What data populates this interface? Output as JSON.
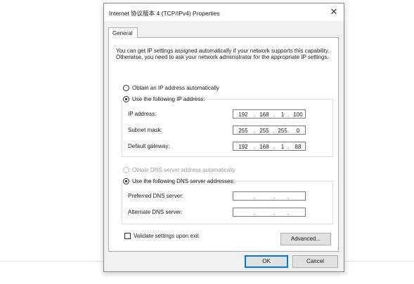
{
  "window": {
    "title": "Internet 协议版本 4 (TCP/IPv4) Properties",
    "close_glyph": "✕"
  },
  "tabs": [
    {
      "label": "General",
      "selected": true
    }
  ],
  "description": "You can get IP settings assigned automatically if your network supports this capability. Otherwise, you need to ask your network administrator for the appropriate IP settings.",
  "ip_mode": {
    "auto_label": "Obtain an IP address automatically",
    "manual_label": "Use the following IP address:",
    "selected": "manual"
  },
  "ip_fields": {
    "ip_address": {
      "label": "IP address:",
      "octets": [
        "192",
        "168",
        "1",
        "100"
      ]
    },
    "subnet_mask": {
      "label": "Subnet mask:",
      "octets": [
        "255",
        "255",
        "255",
        "0"
      ]
    },
    "gateway": {
      "label": "Default gateway:",
      "octets": [
        "192",
        "168",
        "1",
        "88"
      ]
    }
  },
  "dns_mode": {
    "auto_label": "Obtain DNS server address automatically",
    "auto_disabled": true,
    "manual_label": "Use the following DNS server addresses:",
    "selected": "manual"
  },
  "dns_fields": {
    "preferred": {
      "label": "Preferred DNS server:",
      "octets": [
        "",
        "",
        "",
        ""
      ]
    },
    "alternate": {
      "label": "Alternate DNS server:",
      "octets": [
        "",
        "",
        "",
        ""
      ]
    }
  },
  "validate": {
    "label": "Validate settings upon exit",
    "checked": false
  },
  "buttons": {
    "advanced": "Advanced...",
    "ok": "OK",
    "cancel": "Cancel"
  },
  "dot_glyph": "."
}
